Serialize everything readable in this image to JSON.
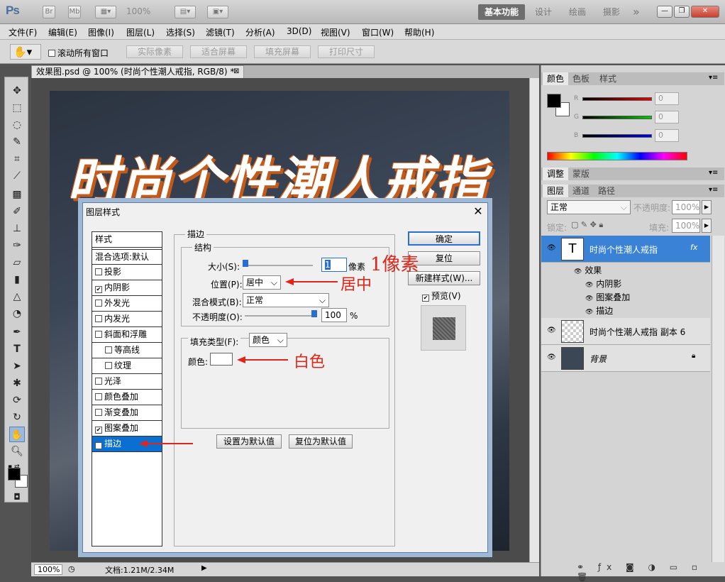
{
  "app": {
    "logo": "Ps",
    "br": "Br",
    "mb": "Mb",
    "zoom": "100%",
    "workspaces": {
      "basic": "基本功能",
      "design": "设计",
      "paint": "绘画",
      "photo": "摄影"
    },
    "more": "»"
  },
  "menu": [
    "文件(F)",
    "编辑(E)",
    "图像(I)",
    "图层(L)",
    "选择(S)",
    "滤镜(T)",
    "分析(A)",
    "3D(D)",
    "视图(V)",
    "窗口(W)",
    "帮助(H)"
  ],
  "options": {
    "scroll_all": "滚动所有窗口",
    "actual_pixels": "实际像素",
    "fit_screen": "适合屏幕",
    "fill_screen": "填充屏幕",
    "print_size": "打印尺寸"
  },
  "document": {
    "tab": "效果图.psd @ 100% (时尚个性潮人戒指, RGB/8) *",
    "canvas_text": "时尚个性潮人戒指",
    "zoom": "100%",
    "doc_info": "文档:1.21M/2.34M"
  },
  "panels": {
    "color_tabs": [
      "颜色",
      "色板",
      "样式"
    ],
    "rgb": [
      {
        "label": "R",
        "value": "0"
      },
      {
        "label": "G",
        "value": "0"
      },
      {
        "label": "B",
        "value": "0"
      }
    ],
    "adjust_tabs": [
      "调整",
      "蒙版"
    ],
    "layer_tabs": [
      "图层",
      "通道",
      "路径"
    ],
    "blend_mode": "正常",
    "opacity_label": "不透明度:",
    "opacity": "100%",
    "lock_label": "锁定:",
    "fill_label": "填充:",
    "fill": "100%",
    "layers": [
      {
        "name": "时尚个性潮人戒指",
        "type": "T",
        "fx": "fx"
      },
      {
        "name": "时尚个性潮人戒指 副本 6"
      },
      {
        "name": "背景"
      }
    ],
    "effects_label": "效果",
    "effects": [
      "内阴影",
      "图案叠加",
      "描边"
    ]
  },
  "dialog": {
    "title": "图层样式",
    "styles_header": "样式",
    "blend_default": "混合选项:默认",
    "style_items": [
      {
        "label": "投影",
        "checked": false,
        "sub": false
      },
      {
        "label": "内阴影",
        "checked": true,
        "sub": false
      },
      {
        "label": "外发光",
        "checked": false,
        "sub": false
      },
      {
        "label": "内发光",
        "checked": false,
        "sub": false
      },
      {
        "label": "斜面和浮雕",
        "checked": false,
        "sub": false
      },
      {
        "label": "等高线",
        "checked": false,
        "sub": true
      },
      {
        "label": "纹理",
        "checked": false,
        "sub": true
      },
      {
        "label": "光泽",
        "checked": false,
        "sub": false
      },
      {
        "label": "颜色叠加",
        "checked": false,
        "sub": false
      },
      {
        "label": "渐变叠加",
        "checked": false,
        "sub": false
      },
      {
        "label": "图案叠加",
        "checked": true,
        "sub": false
      },
      {
        "label": "描边",
        "checked": true,
        "sub": false
      }
    ],
    "stroke_group": "描边",
    "structure_group": "结构",
    "size_label": "大小(S):",
    "size_value": "1",
    "size_unit": "像素",
    "position_label": "位置(P):",
    "position_value": "居中",
    "blend_label": "混合模式(B):",
    "blend_value": "正常",
    "opacity_label": "不透明度(O):",
    "opacity_value": "100",
    "opacity_unit": "%",
    "fill_type_label": "填充类型(F):",
    "fill_type_value": "颜色",
    "color_label": "颜色:",
    "btn_ok": "确定",
    "btn_reset": "复位",
    "btn_new_style": "新建样式(W)...",
    "preview_label": "预览(V)",
    "btn_set_default": "设置为默认值",
    "btn_reset_default": "复位为默认值"
  },
  "annotations": {
    "one_pixel": "1像素",
    "center": "居中",
    "white": "白色"
  },
  "colors": {
    "accent": "#0a6fd1",
    "annotation": "#e0261a",
    "stroke_orange": "#c35a1a"
  }
}
